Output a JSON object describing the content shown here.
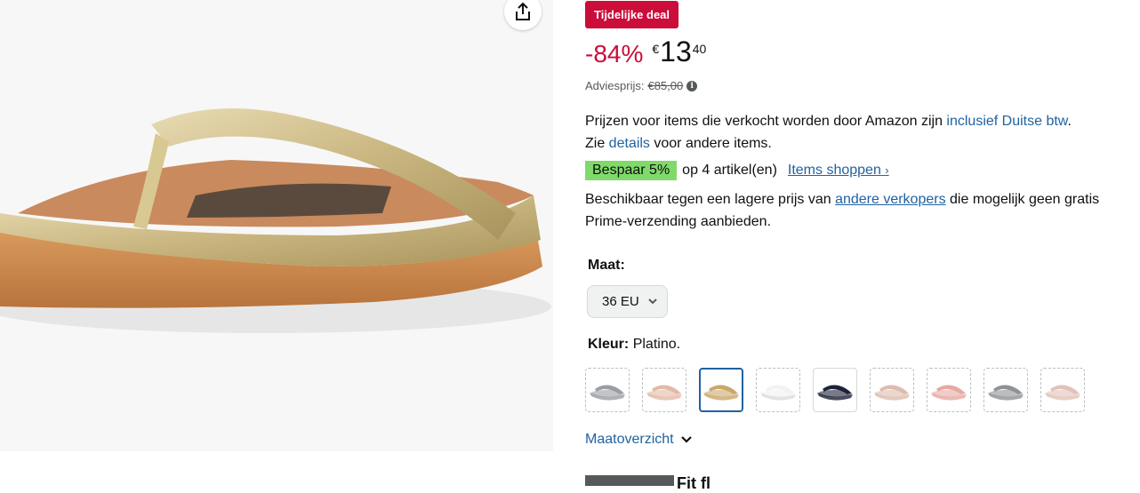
{
  "product_image": {
    "alt": "FitFlop teenslipper Platino"
  },
  "deal_badge": "Tijdelijke deal",
  "price": {
    "discount": "-84%",
    "currency": "€",
    "whole": "13",
    "fraction": "40"
  },
  "list_price": {
    "label": "Adviesprijs:",
    "value": "€85,00"
  },
  "vat": {
    "text1": "Prijzen voor items die verkocht worden door Amazon zijn ",
    "link1": "inclusief Duitse btw",
    "text2": ".",
    "text3": "Zie ",
    "link2": "details",
    "text4": " voor andere items."
  },
  "savings": {
    "badge": "Bespaar 5%",
    "text": "op 4 artikel(en)",
    "link": "Items shoppen"
  },
  "availability": {
    "text1": "Beschikbaar tegen een lagere prijs van ",
    "link": "andere verkopers",
    "text2": " die mogelijk geen gratis Prime-verzending aanbieden."
  },
  "size": {
    "label": "Maat:",
    "selected": "36 EU"
  },
  "color": {
    "label": "Kleur:",
    "value": "Platino."
  },
  "swatches": [
    {
      "color": "#9a9ea2",
      "selected": false
    },
    {
      "color": "#e3b9a6",
      "selected": false
    },
    {
      "color": "#c9a86a",
      "selected": true
    },
    {
      "color": "#f2f2f2",
      "selected": false
    },
    {
      "color": "#1d2238",
      "selected": false
    },
    {
      "color": "#dcbcae",
      "selected": false
    },
    {
      "color": "#e6a9a2",
      "selected": false
    },
    {
      "color": "#8e9296",
      "selected": false
    },
    {
      "color": "#e2c2b8",
      "selected": false
    }
  ],
  "size_chart": "Maatoverzicht",
  "bottom": {
    "text": "Fit fl"
  }
}
